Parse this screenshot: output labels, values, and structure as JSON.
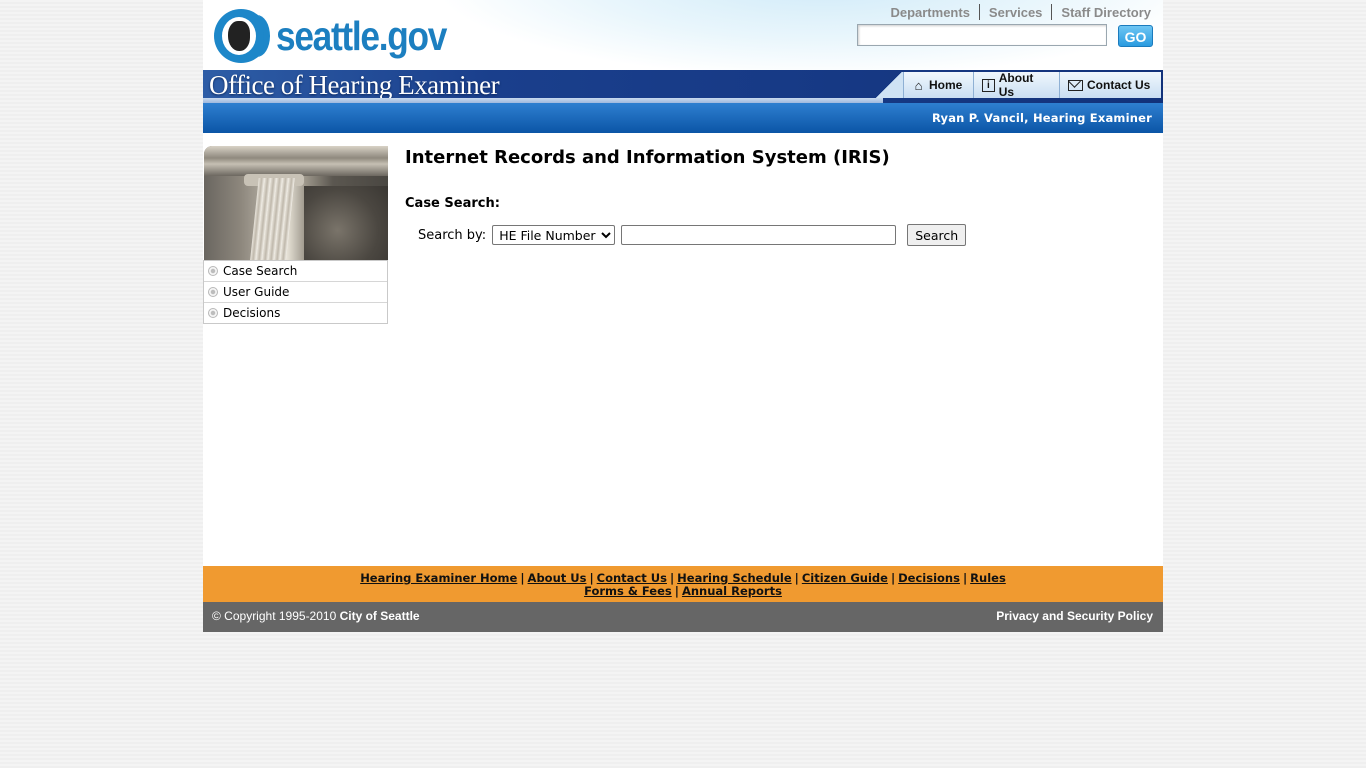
{
  "header": {
    "logo_text": "seattle.gov",
    "top_links": [
      "Departments",
      "Services",
      "Staff Directory"
    ],
    "search_placeholder": "",
    "go_label": "GO"
  },
  "banner": {
    "title": "Office of Hearing Examiner",
    "nav": [
      {
        "label": "Home",
        "icon": "home-icon"
      },
      {
        "label": "About Us",
        "icon": "info-icon"
      },
      {
        "label": "Contact Us",
        "icon": "envelope-icon"
      }
    ],
    "subtitle": "Ryan P. Vancil, Hearing Examiner"
  },
  "sidebar": {
    "items": [
      {
        "label": "Case Search"
      },
      {
        "label": "User Guide"
      },
      {
        "label": "Decisions"
      }
    ]
  },
  "main": {
    "title": "Internet Records and Information System (IRIS)",
    "section_label": "Case Search:",
    "search_by_label": "Search by:",
    "search_by_selected": "HE File Number",
    "search_value": "",
    "search_button": "Search"
  },
  "footer": {
    "links_row1": [
      "Hearing Examiner Home",
      "About Us",
      "Contact Us",
      "Hearing Schedule",
      "Citizen Guide",
      "Decisions",
      "Rules"
    ],
    "links_row2": [
      "Forms & Fees",
      "Annual Reports"
    ],
    "copyright_prefix": "© Copyright 1995-2010 ",
    "copyright_owner": "City of Seattle",
    "privacy": "Privacy and Security Policy"
  },
  "colors": {
    "brand_blue": "#1c7fc0",
    "banner_navy": "#173a86",
    "footer_orange": "#f09a30",
    "footer_gray": "#666666"
  }
}
